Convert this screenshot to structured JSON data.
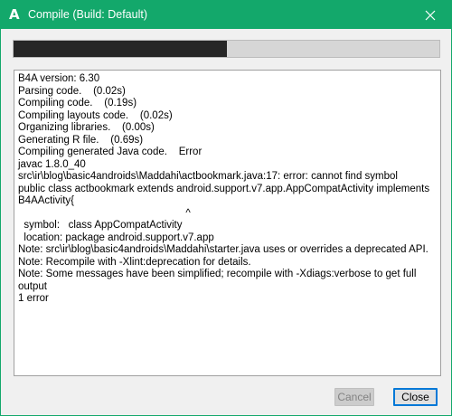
{
  "window": {
    "icon_glyph": "A",
    "title": "Compile (Build: Default)",
    "accent_color": "#13a86b"
  },
  "progress": {
    "fraction": 0.5
  },
  "log": {
    "lines": [
      "B4A version: 6.30",
      "Parsing code.    (0.02s)",
      "Compiling code.    (0.19s)",
      "Compiling layouts code.    (0.02s)",
      "Organizing libraries.    (0.00s)",
      "Generating R file.    (0.69s)",
      "Compiling generated Java code.    Error",
      "javac 1.8.0_40",
      "src\\ir\\blog\\basic4androids\\Maddahi\\actbookmark.java:17: error: cannot find symbol",
      "public class actbookmark extends android.support.v7.app.AppCompatActivity implements B4AActivity{",
      "                                                          ^",
      "  symbol:   class AppCompatActivity",
      "  location: package android.support.v7.app",
      "Note: src\\ir\\blog\\basic4androids\\Maddahi\\starter.java uses or overrides a deprecated API.",
      "Note: Recompile with -Xlint:deprecation for details.",
      "Note: Some messages have been simplified; recompile with -Xdiags:verbose to get full output",
      "1 error"
    ]
  },
  "buttons": {
    "cancel_label": "Cancel",
    "close_label": "Close"
  }
}
